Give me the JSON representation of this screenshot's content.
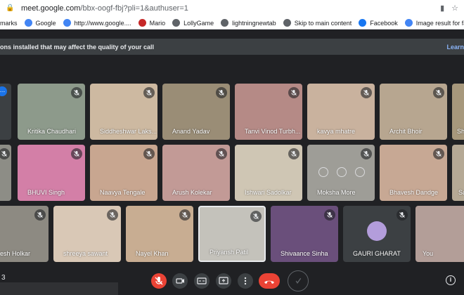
{
  "browser": {
    "url_host": "meet.google.com",
    "url_path": "/bbx-oogf-fbj?pli=1&authuser=1"
  },
  "bookmarks": [
    {
      "label": "marks",
      "icon": "bookmark-icon",
      "color": "#ffffff"
    },
    {
      "label": "Google",
      "icon": "google-icon",
      "color": "#4285f4"
    },
    {
      "label": "http://www.google....",
      "icon": "google-icon",
      "color": "#4285f4"
    },
    {
      "label": "Mario",
      "icon": "mario-icon",
      "color": "#c62828"
    },
    {
      "label": "LollyGame",
      "icon": "globe-icon",
      "color": "#5f6368"
    },
    {
      "label": "lightningnewtab",
      "icon": "globe-icon",
      "color": "#5f6368"
    },
    {
      "label": "Skip to main content",
      "icon": "globe-icon",
      "color": "#5f6368"
    },
    {
      "label": "Facebook",
      "icon": "facebook-icon",
      "color": "#1877f2"
    },
    {
      "label": "Image result for fan...",
      "icon": "google-icon",
      "color": "#4285f4"
    }
  ],
  "notice": {
    "text": "ons installed that may affect the quality of your call",
    "link": "Learn"
  },
  "participants_row1": [
    "Kritika Chaudhari",
    "Siddheshwar Laks...",
    "Anand Yadav",
    "Tanvi Vinod Turbh...",
    "kavya mhatre",
    "Archit Bhoir",
    "Sh"
  ],
  "participants_row2": [
    "BHUVI Singh",
    "Naavya Tengale",
    "Arush Kolekar",
    "Ishwari Sadolkar",
    "Moksha More",
    "Bhavesh Dandge",
    "Sa"
  ],
  "participants_row3": [
    "esh Holkar",
    "shreeya sawant",
    "Nayel Khan",
    "Priyansh Patil",
    "Shivaance Sinha",
    "GAURI GHARAT",
    "You"
  ],
  "footer": {
    "left_code": "3",
    "info_glyph": "i"
  },
  "colors": {
    "accent": "#1a73e8",
    "danger": "#ea4335",
    "tile_bg": "#3c4043",
    "link": "#8ab4f8"
  }
}
